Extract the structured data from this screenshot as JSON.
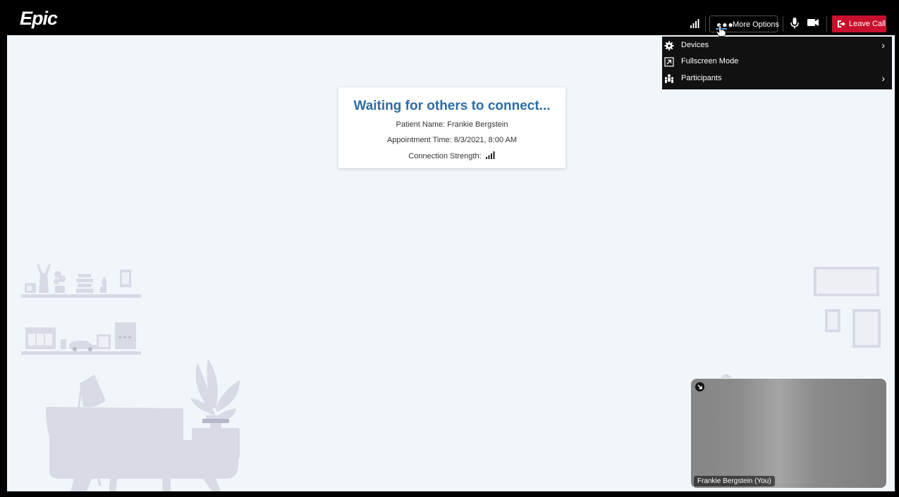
{
  "app": {
    "logo_text": "Epic"
  },
  "toolbar": {
    "more_options_label": "More Options",
    "leave_call_label": "Leave Call"
  },
  "more_menu": {
    "items": [
      {
        "label": "Devices",
        "icon": "gear-icon",
        "has_submenu": true
      },
      {
        "label": "Fullscreen Mode",
        "icon": "fullscreen-icon",
        "has_submenu": false
      },
      {
        "label": "Participants",
        "icon": "participants-icon",
        "has_submenu": true
      }
    ]
  },
  "waiting_card": {
    "title": "Waiting for others to connect...",
    "patient_name": "Patient Name: Frankie Bergstein",
    "appointment_time": "Appointment Time: 8/3/2021, 8:00 AM",
    "connection_strength": "Connection Strength:"
  },
  "self_view": {
    "name_label": "Frankie Bergstein (You)"
  },
  "colors": {
    "accent_blue": "#2e6da4",
    "leave_red": "#c8102e",
    "stage_bg": "#f1f6fb",
    "illustration": "#d8dae6"
  }
}
